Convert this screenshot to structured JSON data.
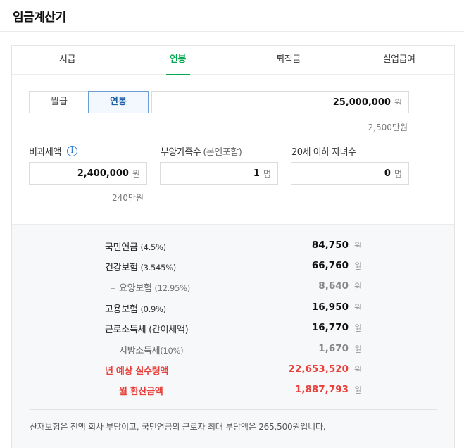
{
  "title": "임금계산기",
  "tabs": [
    {
      "label": "시급"
    },
    {
      "label": "연봉"
    },
    {
      "label": "퇴직금"
    },
    {
      "label": "실업급여"
    }
  ],
  "active_tab": "연봉",
  "segment": {
    "monthly": "월급",
    "yearly": "연봉"
  },
  "salary": {
    "value": "25,000,000",
    "unit": "원",
    "hint": "2,500만원"
  },
  "nontax": {
    "label": "비과세액",
    "value": "2,400,000",
    "unit": "원",
    "hint": "240만원"
  },
  "dependents": {
    "label": "부양가족수",
    "paren": "(본인포함)",
    "value": "1",
    "unit": "명"
  },
  "children": {
    "label": "20세 이하 자녀수",
    "value": "0",
    "unit": "명"
  },
  "results": [
    {
      "name": "국민연금",
      "rate": "(4.5%)",
      "amount": "84,750",
      "unit": "원"
    },
    {
      "name": "건강보험",
      "rate": "(3.545%)",
      "amount": "66,760",
      "unit": "원"
    },
    {
      "name": "요양보험",
      "rate": "(12.95%)",
      "amount": "8,640",
      "unit": "원"
    },
    {
      "name": "고용보험",
      "rate": "(0.9%)",
      "amount": "16,950",
      "unit": "원"
    },
    {
      "name": "근로소득세",
      "rate": "(간이세액)",
      "amount": "16,770",
      "unit": "원"
    },
    {
      "name": "지방소득세",
      "rate": "(10%)",
      "amount": "1,670",
      "unit": "원"
    },
    {
      "name": "년 예상 실수령액",
      "rate": "",
      "amount": "22,653,520",
      "unit": "원"
    },
    {
      "name": "월 환산금액",
      "rate": "",
      "amount": "1,887,793",
      "unit": "원"
    }
  ],
  "note": "산재보험은 전액 회사 부담이고, 국민연금의 근로자 최대 부담액은 265,500원입니다.",
  "colors": {
    "accent": "#03a94f",
    "highlight": "#e8403b",
    "info": "#2b7bd6"
  }
}
